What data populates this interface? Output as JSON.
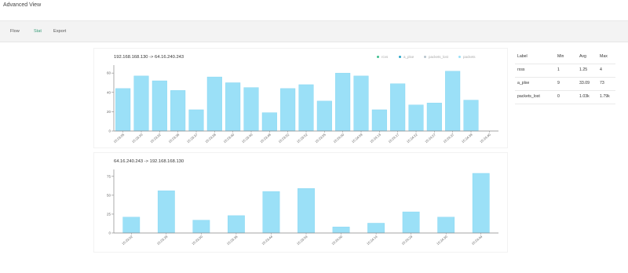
{
  "window": {
    "title": "Advanced View"
  },
  "tabs": [
    {
      "label": "Flow"
    },
    {
      "label": "Stat"
    },
    {
      "label": "Export"
    }
  ],
  "colors": {
    "bar": "#9be0f7",
    "bar_stroke": "#7fd3f0",
    "active_tab": "#3a9e7a",
    "axis": "#888888"
  },
  "chart_data": [
    {
      "type": "bar",
      "title": "192.168.168.130 -> 64.16.240.243",
      "legend": [
        "rcvs",
        "a_plxe",
        "packets_lost",
        "packets"
      ],
      "legend_placement": "top-right",
      "categories": [
        "15:23:05",
        "15:23:20",
        "15:23:32",
        "15:23:38",
        "15:23:37",
        "15:23:38",
        "15:23:40",
        "15:23:40",
        "15:23:48",
        "15:23:52",
        "15:23:52",
        "15:23:55",
        "15:24:00",
        "15:24:09",
        "15:24:13",
        "15:24:17",
        "15:24:22",
        "15:24:27",
        "15:24:37",
        "15:24:38",
        "15:24:40"
      ],
      "values": [
        44,
        57,
        52,
        42,
        22,
        56,
        50,
        45,
        19,
        44,
        48,
        31,
        60,
        57,
        22,
        49,
        27,
        29,
        62,
        32,
        0
      ],
      "yticks": [
        0,
        20,
        40,
        60
      ],
      "ylim": [
        0,
        65
      ],
      "xlabel": "",
      "ylabel": ""
    },
    {
      "type": "bar",
      "title": "64.16.240.243 -> 192.168.168.130",
      "categories": [
        "15:23:02",
        "15:23:28",
        "15:23:30",
        "15:23:36",
        "15:23:44",
        "15:23:54",
        "15:24:00",
        "15:24:14",
        "15:24:29",
        "15:24:30",
        "15:24:44"
      ],
      "values": [
        21,
        56,
        17,
        23,
        55,
        59,
        8,
        13,
        28,
        21,
        79
      ],
      "yticks": [
        0,
        25,
        50,
        75
      ],
      "ylim": [
        0,
        80
      ],
      "xlabel": "",
      "ylabel": ""
    }
  ],
  "stats": {
    "headers": [
      "Label",
      "Min",
      "Avg",
      "Max"
    ],
    "rows": [
      [
        "rxss",
        "1",
        "1.25",
        "4"
      ],
      [
        "a_plxe",
        "9",
        "33.09",
        "73"
      ],
      [
        "packets_lost",
        "0",
        "1.03k",
        "1.79k"
      ]
    ]
  }
}
